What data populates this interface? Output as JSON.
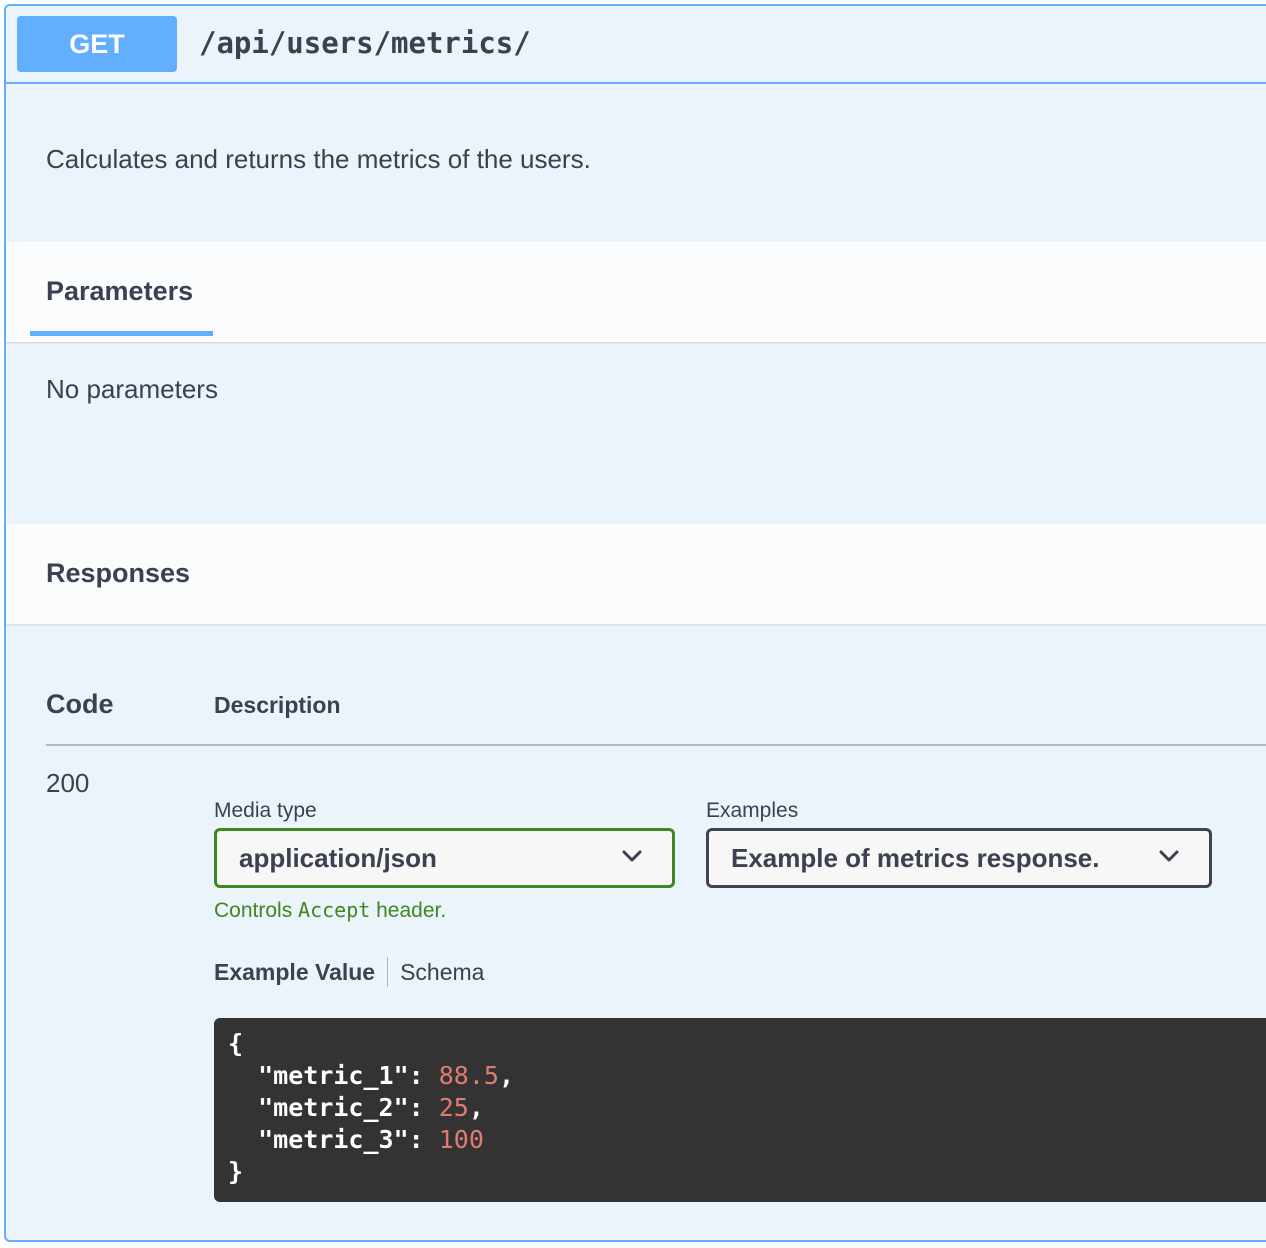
{
  "operation": {
    "method": "GET",
    "path": "/api/users/metrics/",
    "description": "Calculates and returns the metrics of the users."
  },
  "parameters": {
    "title": "Parameters",
    "empty_text": "No parameters"
  },
  "responses": {
    "title": "Responses",
    "col_code": "Code",
    "col_description": "Description",
    "rows": [
      {
        "code": "200",
        "media_type_label": "Media type",
        "media_type_value": "application/json",
        "examples_label": "Examples",
        "examples_value": "Example of metrics response.",
        "controls_prefix": "Controls ",
        "controls_mono": "Accept",
        "controls_suffix": " header.",
        "tab_example": "Example Value",
        "tab_schema": "Schema",
        "example": {
          "open": "{",
          "lines": [
            {
              "key": "\"metric_1\"",
              "value": "88.5",
              "trail": ","
            },
            {
              "key": "\"metric_2\"",
              "value": "25",
              "trail": ","
            },
            {
              "key": "\"metric_3\"",
              "value": "100",
              "trail": ""
            }
          ],
          "close": "}"
        }
      }
    ]
  },
  "colors": {
    "get_accent": "#61affe",
    "block_bg": "#ebf3fb",
    "green": "#41871f",
    "code_bg": "#333333",
    "number": "#e07b73"
  },
  "icons": [
    "chevron-down-icon"
  ]
}
